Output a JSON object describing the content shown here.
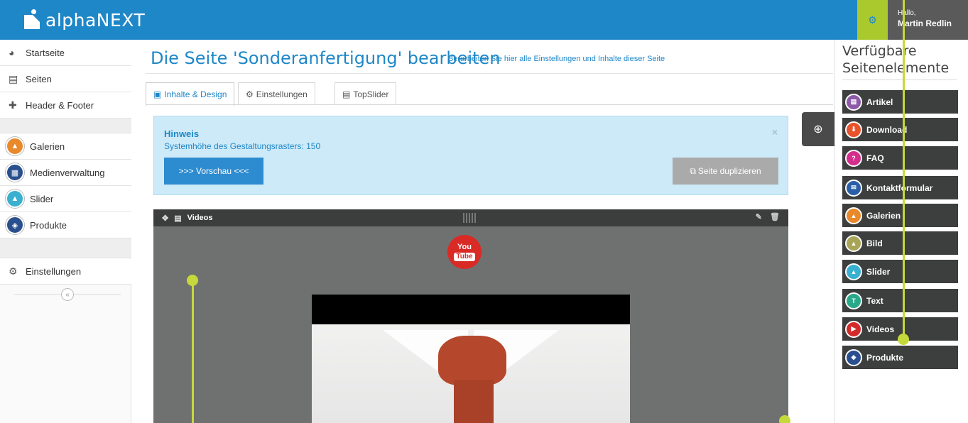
{
  "app": {
    "name": "alphaNEXT"
  },
  "user": {
    "greeting": "Hallo,",
    "name": "Martin Redlin"
  },
  "sidebar": {
    "items": [
      {
        "label": "Startseite",
        "icon": "dashboard-icon"
      },
      {
        "label": "Seiten",
        "icon": "page-icon"
      },
      {
        "label": "Header & Footer",
        "icon": "puzzle-icon"
      },
      {
        "label": "Galerien",
        "icon": "gallery-icon",
        "color": "#e8892b"
      },
      {
        "label": "Medienverwaltung",
        "icon": "media-grid-icon",
        "color": "#2a4f8f"
      },
      {
        "label": "Slider",
        "icon": "slider-icon",
        "color": "#39b0d0"
      },
      {
        "label": "Produkte",
        "icon": "box-icon",
        "color": "#2a4f8f"
      },
      {
        "label": "Einstellungen",
        "icon": "gear-icon"
      }
    ],
    "collapse": "«"
  },
  "main": {
    "title": "Die Seite 'Sonderanfertigung' bearbeiten",
    "subtitle": "Berarbeiten Sie hier alle Einstellungen und Inhalte dieser Seite",
    "tabs": [
      {
        "label": "Inhalte & Design",
        "active": true
      },
      {
        "label": "Einstellungen",
        "active": false
      },
      {
        "label": "TopSlider",
        "active": false
      }
    ],
    "hint": {
      "title": "Hinweis",
      "text": "Systemhöhe des Gestaltungsrasters: 150",
      "close": "×",
      "preview_button": ">>> Vorschau <<<",
      "duplicate_button": "Seite duplizieren"
    },
    "video_block": {
      "label": "Videos",
      "logo_you": "You",
      "logo_tube": "Tube"
    }
  },
  "right_panel": {
    "title": "Verfügbare Seitenelemente",
    "elements": [
      {
        "label": "Artikel",
        "color": "#8e5aa8",
        "icon": "article-icon"
      },
      {
        "label": "Download",
        "color": "#e8532b",
        "icon": "download-icon"
      },
      {
        "label": "FAQ",
        "color": "#d42d8c",
        "icon": "faq-icon"
      },
      {
        "label": "Kontaktformular",
        "color": "#2a5fa8",
        "icon": "mail-icon"
      },
      {
        "label": "Galerien",
        "color": "#e8892b",
        "icon": "gallery-icon"
      },
      {
        "label": "Bild",
        "color": "#a8a458",
        "icon": "image-icon"
      },
      {
        "label": "Slider",
        "color": "#39b0d0",
        "icon": "slider-icon"
      },
      {
        "label": "Text",
        "color": "#2aa88a",
        "icon": "text-icon"
      },
      {
        "label": "Videos",
        "color": "#d42a2a",
        "icon": "video-icon"
      },
      {
        "label": "Produkte",
        "color": "#2a4f8f",
        "icon": "box-icon"
      }
    ]
  },
  "colors": {
    "brand": "#1e87c8",
    "accent": "#a9c92d",
    "annotation": "#c5d93a"
  }
}
